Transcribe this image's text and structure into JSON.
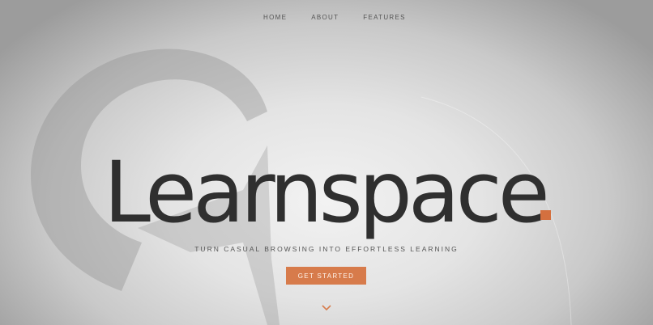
{
  "nav": {
    "items": [
      {
        "label": "HOME"
      },
      {
        "label": "ABOUT"
      },
      {
        "label": "FEATURES"
      }
    ]
  },
  "hero": {
    "brand_name": "Learnspace",
    "tagline": "TURN CASUAL BROWSING INTO EFFORTLESS LEARNING",
    "cta_label": "GET STARTED",
    "scroll_icon": "chevron-down-icon"
  },
  "colors": {
    "accent": "#d77b4b",
    "text_dark": "#2f2f2f",
    "text_muted": "#555555",
    "background_light": "#f2f2f2",
    "background_dark": "#9c9c9c"
  }
}
